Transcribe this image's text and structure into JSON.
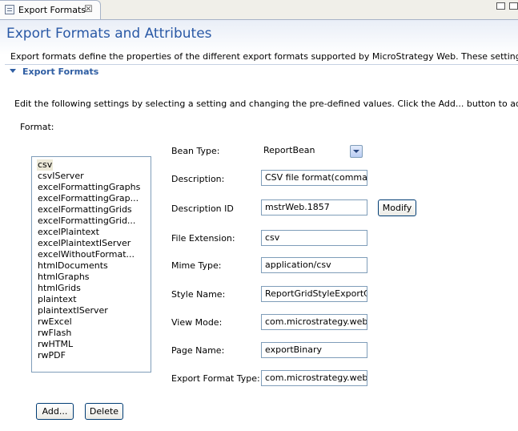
{
  "tab": {
    "label": "Export Formats",
    "close": "☒"
  },
  "page": {
    "title": "Export Formats and Attributes",
    "description": "Export formats define the properties of the different export formats supported by MicroStrategy Web. These settings are defined in"
  },
  "section": {
    "title": "Export Formats",
    "description": "Edit the following settings by selecting a setting and changing the pre-defined values. Click the Add... button to add new settings.",
    "format_label": "Format:"
  },
  "formats": [
    "csv",
    "csvIServer",
    "excelFormattingGraphs",
    "excelFormattingGrap...",
    "excelFormattingGrids",
    "excelFormattingGrid...",
    "excelPlaintext",
    "excelPlaintextIServer",
    "excelWithoutFormat...",
    "htmlDocuments",
    "htmlGraphs",
    "htmlGrids",
    "plaintext",
    "plaintextIServer",
    "rwExcel",
    "rwFlash",
    "rwHTML",
    "rwPDF"
  ],
  "selected_format": "csv",
  "properties": {
    "bean_type": {
      "label": "Bean Type:",
      "value": "ReportBean"
    },
    "description": {
      "label": "Description:",
      "value": "CSV file format(comma se"
    },
    "description_id": {
      "label": "Description ID",
      "value": "mstrWeb.1857"
    },
    "file_extension": {
      "label": "File Extension:",
      "value": "csv"
    },
    "mime_type": {
      "label": "Mime Type:",
      "value": "application/csv"
    },
    "style_name": {
      "label": "Style Name:",
      "value": "ReportGridStyleExportCS"
    },
    "view_mode": {
      "label": "View Mode:",
      "value": "com.microstrategy.web.c"
    },
    "page_name": {
      "label": "Page Name:",
      "value": "exportBinary"
    },
    "export_format_type": {
      "label": "Export Format Type:",
      "value": "com.microstrategy.web.a"
    }
  },
  "buttons": {
    "modify": "Modify",
    "add": "Add...",
    "delete": "Delete"
  },
  "colors": {
    "title": "#2a59a6",
    "section": "#2f5ea3",
    "border": "#7f9db9"
  }
}
